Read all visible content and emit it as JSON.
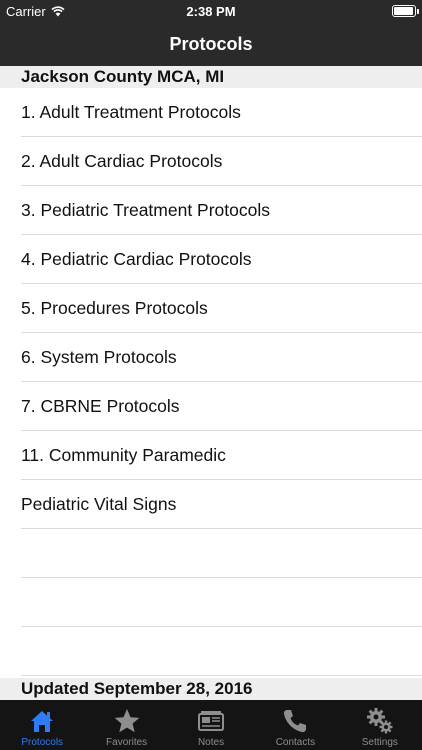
{
  "status_bar": {
    "carrier": "Carrier",
    "time": "2:38 PM"
  },
  "nav": {
    "title": "Protocols"
  },
  "section": {
    "header": "Jackson County MCA, MI",
    "footer": "Updated September 28, 2016"
  },
  "list": {
    "items": [
      "1. Adult Treatment Protocols",
      "2. Adult Cardiac Protocols",
      "3. Pediatric Treatment Protocols",
      "4. Pediatric Cardiac Protocols",
      "5. Procedures Protocols",
      "6. System Protocols",
      "7. CBRNE Protocols",
      "11. Community Paramedic",
      "Pediatric Vital Signs"
    ]
  },
  "tabbar": {
    "tabs": [
      {
        "label": "Protocols",
        "icon": "home-icon",
        "active": true
      },
      {
        "label": "Favorites",
        "icon": "star-icon",
        "active": false
      },
      {
        "label": "Notes",
        "icon": "notes-icon",
        "active": false
      },
      {
        "label": "Contacts",
        "icon": "phone-icon",
        "active": false
      },
      {
        "label": "Settings",
        "icon": "gear-icon",
        "active": false
      }
    ]
  },
  "colors": {
    "bar_background": "#2a2a2a",
    "tabbar_background": "#141414",
    "accent": "#2f7cf6",
    "section_background": "#eeeeee"
  }
}
